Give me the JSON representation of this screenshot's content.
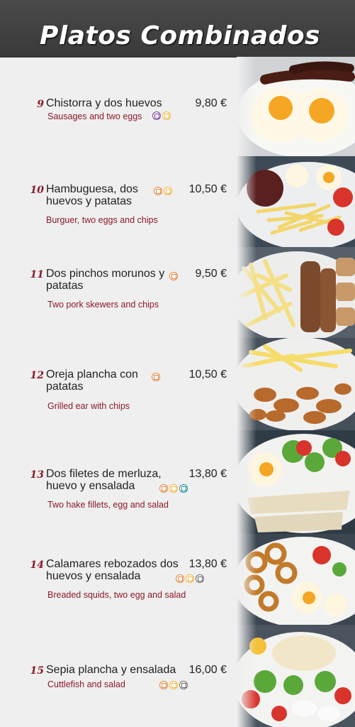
{
  "header": {
    "title": "Platos Combinados"
  },
  "items": [
    {
      "num": "9",
      "name": "Chistorra y dos huevos",
      "price": "9,80 €",
      "desc": "Sausages and two eggs",
      "allergens": [
        "purple",
        "yellow"
      ]
    },
    {
      "num": "10",
      "name": "Hambuguesa, dos huevos y patatas",
      "price": "10,50 €",
      "desc": "Burguer, two eggs and chips",
      "allergens": [
        "orange",
        "yellow"
      ]
    },
    {
      "num": "11",
      "name": "Dos pinchos morunos y patatas",
      "price": "9,50 €",
      "desc": "Two pork skewers and chips",
      "allergens": [
        "orange"
      ]
    },
    {
      "num": "12",
      "name": "Oreja plancha con patatas",
      "price": "10,50 €",
      "desc": "Grilled ear with chips",
      "allergens": [
        "orange"
      ]
    },
    {
      "num": "13",
      "name": "Dos filetes de merluza, huevo y ensalada",
      "price": "13,80 €",
      "desc": "Two hake fillets, egg and salad",
      "allergens": [
        "orange",
        "yellow",
        "teal"
      ]
    },
    {
      "num": "14",
      "name": "Calamares rebozados dos huevos y ensalada",
      "price": "13,80 €",
      "desc": "Breaded squids, two egg and salad",
      "allergens": [
        "orange",
        "yellow",
        "gray"
      ]
    },
    {
      "num": "15",
      "name": "Sepia plancha y ensalada",
      "price": "16,00 €",
      "desc": "Cuttlefish and salad",
      "allergens": [
        "orange",
        "yellow",
        "gray"
      ]
    }
  ]
}
